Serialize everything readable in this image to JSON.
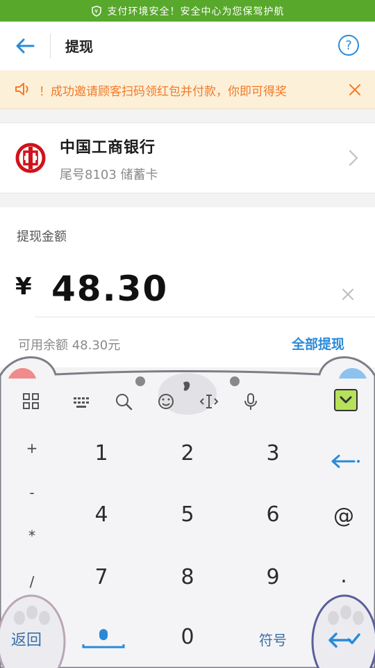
{
  "banner": {
    "text": "支付环境安全！安全中心为您保驾护航"
  },
  "header": {
    "title": "提现"
  },
  "notice": {
    "text": "！成功邀请顾客扫码领红包并付款，你即可得奖"
  },
  "bank": {
    "name": "中国工商银行",
    "subtitle": "尾号8103 储蓄卡"
  },
  "amount": {
    "label": "提现金额",
    "currency": "¥",
    "value": "48.30",
    "available": "可用余额 48.30元",
    "withdraw_all": "全部提现"
  },
  "keyboard": {
    "symbols_left": [
      "+",
      "-",
      "*",
      "/"
    ],
    "rows": [
      [
        "1",
        "2",
        "3"
      ],
      [
        "4",
        "5",
        "6"
      ],
      [
        "7",
        "8",
        "9"
      ]
    ],
    "right_keys": [
      "@",
      "."
    ],
    "bottom": {
      "back": "返回",
      "zero": "0",
      "symbols": "符号"
    }
  },
  "colors": {
    "banner_green": "#57a82b",
    "accent_blue": "#2a8ad8",
    "notice_orange": "#f07a2a",
    "bank_red": "#d0121b"
  }
}
